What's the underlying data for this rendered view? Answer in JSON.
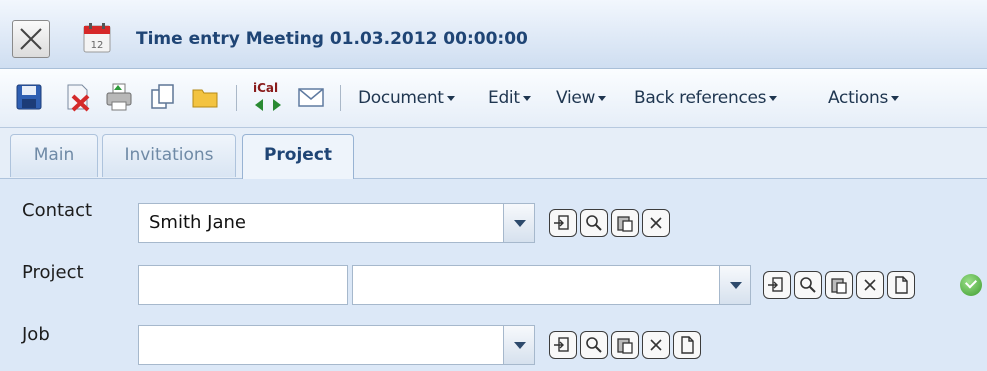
{
  "window": {
    "title": "Time entry Meeting 01.03.2012 00:00:00"
  },
  "toolbar": {
    "icons": [
      "save-icon",
      "delete-icon",
      "print-icon",
      "copy-icon",
      "folder-icon",
      "ical-icon",
      "email-icon"
    ],
    "ical_label": "iCal",
    "menus": [
      {
        "label": "Document"
      },
      {
        "label": "Edit"
      },
      {
        "label": "View"
      },
      {
        "label": "Back references"
      },
      {
        "label": "Actions"
      }
    ]
  },
  "tabs": [
    {
      "label": "Main",
      "active": false
    },
    {
      "label": "Invitations",
      "active": false
    },
    {
      "label": "Project",
      "active": true
    }
  ],
  "form": {
    "contact": {
      "label": "Contact",
      "value": "Smith Jane"
    },
    "project": {
      "label": "Project",
      "code_value": "",
      "name_value": ""
    },
    "job": {
      "label": "Job",
      "value": ""
    }
  },
  "colors": {
    "accent": "#1f4575",
    "panel": "#dce8f7",
    "ok": "#3e9c2e"
  }
}
